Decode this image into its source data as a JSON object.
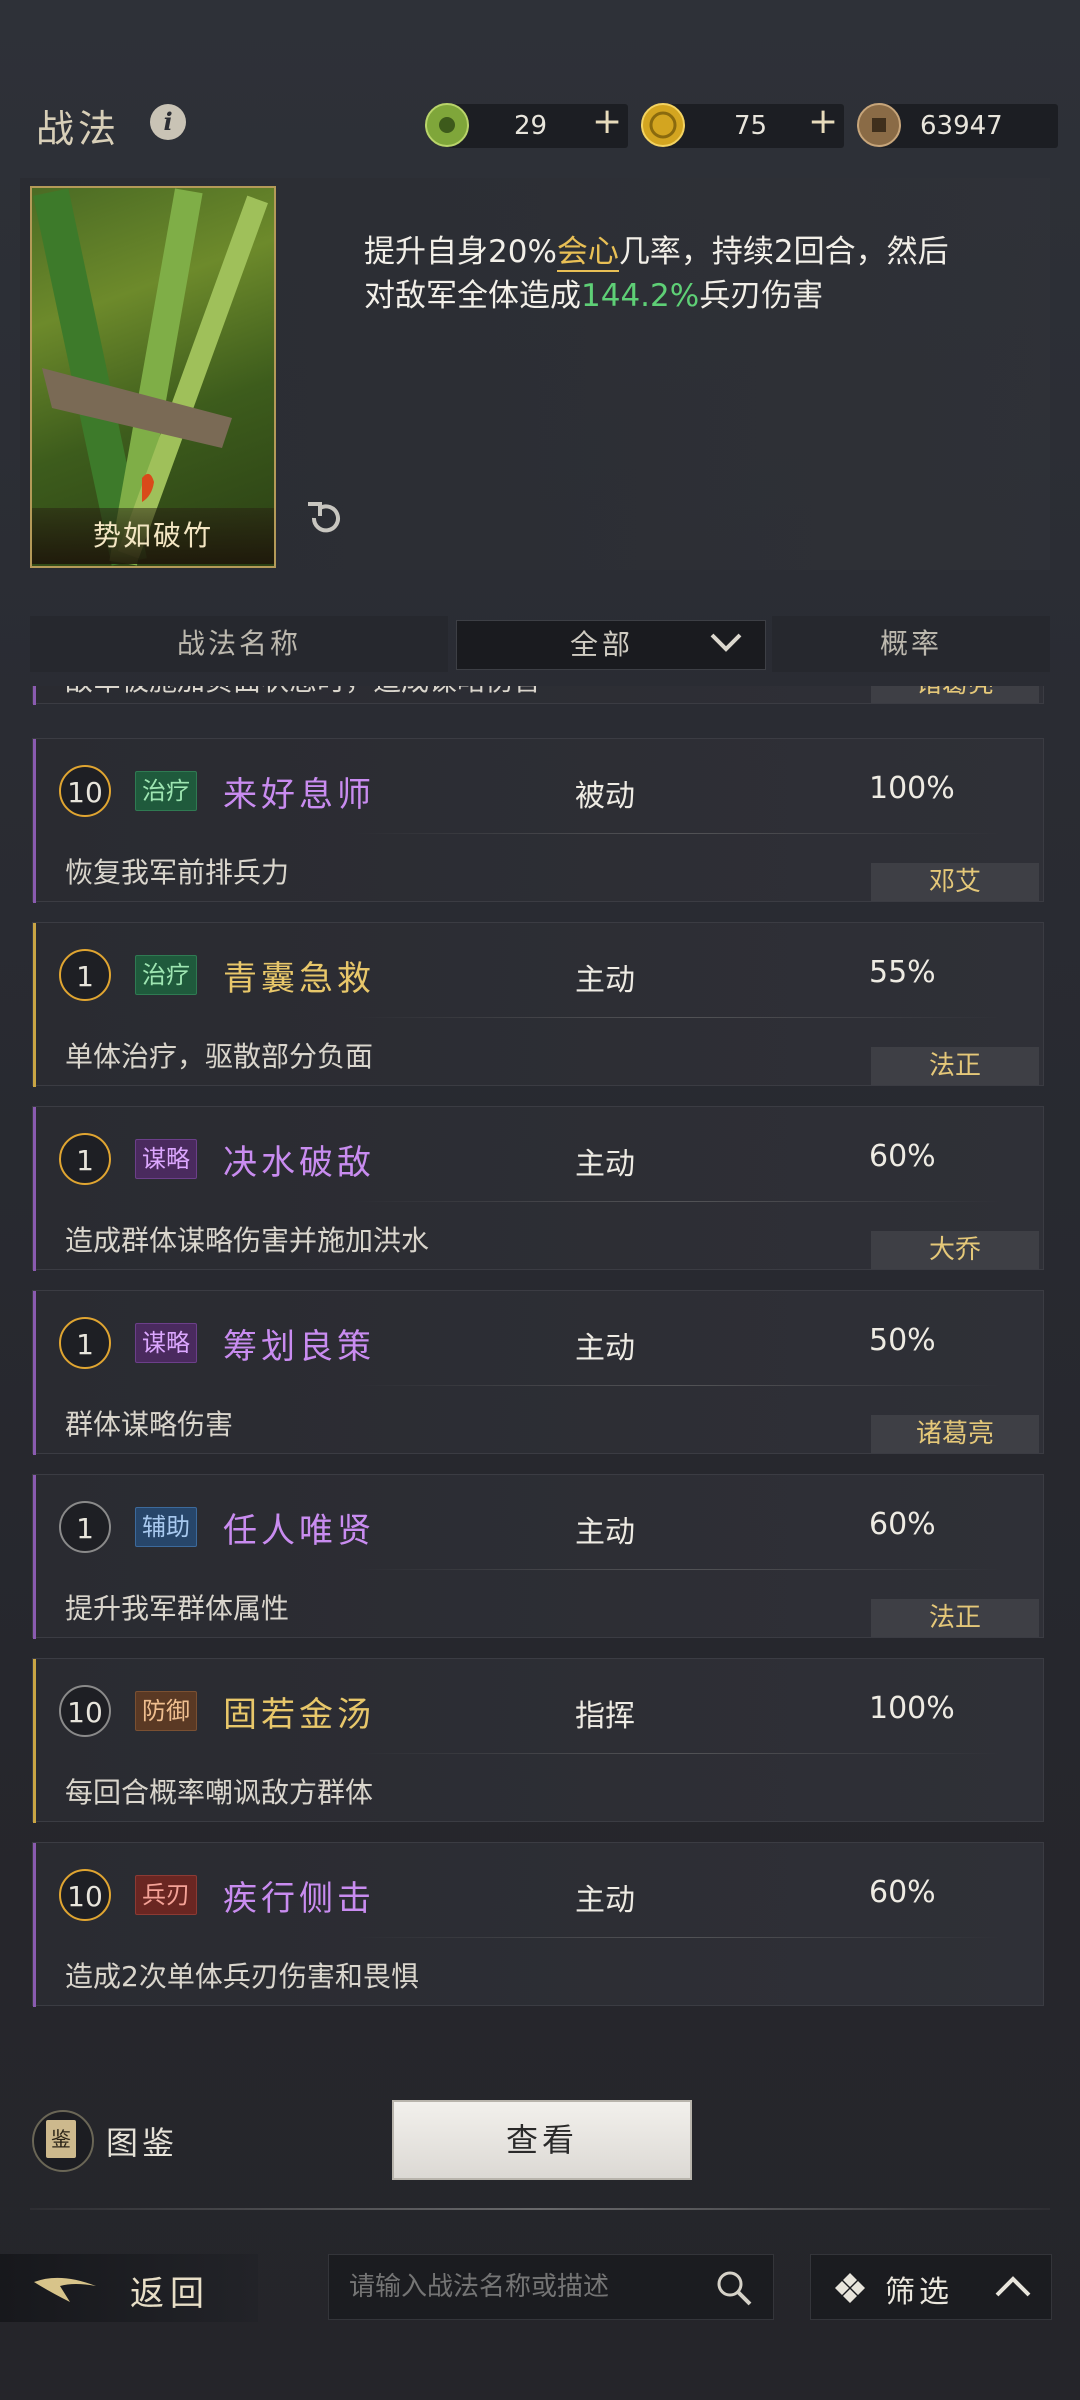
{
  "header": {
    "title": "战法",
    "currencies": [
      {
        "icon": "jade-coin-icon",
        "value": "29"
      },
      {
        "icon": "gold-coin-icon",
        "value": "75"
      },
      {
        "icon": "copper-coin-icon",
        "value": "63947"
      }
    ],
    "plus": "+"
  },
  "detail": {
    "card_name": "势如破竹",
    "desc_1": "提升自身20%",
    "desc_hl1": "会心",
    "desc_2": "几率，持续2回合，然后",
    "desc_3": "对敌军全体造成",
    "desc_hl2": "144.2%",
    "desc_4": "兵刃伤害"
  },
  "columns": {
    "name": "战法名称",
    "filter": "全部",
    "rate": "概率"
  },
  "list": {
    "partial_desc": "敌军被施加负面状态时，造成谋略伤害",
    "partial_owner": "诸葛亮",
    "rows": [
      {
        "cost": "10",
        "tag": "治疗",
        "name": "来好息师",
        "type": "被动",
        "rate": "100%",
        "desc": "恢复我军前排兵力",
        "owner": "邓艾"
      },
      {
        "cost": "1",
        "tag": "治疗",
        "name": "青囊急救",
        "type": "主动",
        "rate": "55%",
        "desc": "单体治疗，驱散部分负面",
        "owner": "法正"
      },
      {
        "cost": "1",
        "tag": "谋略",
        "name": "决水破敌",
        "type": "主动",
        "rate": "60%",
        "desc": "造成群体谋略伤害并施加洪水",
        "owner": "大乔"
      },
      {
        "cost": "1",
        "tag": "谋略",
        "name": "筹划良策",
        "type": "主动",
        "rate": "50%",
        "desc": "群体谋略伤害",
        "owner": "诸葛亮"
      },
      {
        "cost": "1",
        "tag": "辅助",
        "name": "任人唯贤",
        "type": "主动",
        "rate": "60%",
        "desc": "提升我军群体属性",
        "owner": "法正"
      },
      {
        "cost": "10",
        "tag": "防御",
        "name": "固若金汤",
        "type": "指挥",
        "rate": "100%",
        "desc": "每回合概率嘲讽敌方群体",
        "owner": ""
      },
      {
        "cost": "10",
        "tag": "兵刃",
        "name": "疾行侧击",
        "type": "主动",
        "rate": "60%",
        "desc": "造成2次单体兵刃伤害和畏惧",
        "owner": ""
      }
    ]
  },
  "footer": {
    "codex_icon_char": "鉴",
    "codex_label": "图鉴",
    "view_button": "查看",
    "back_label": "返回",
    "search_placeholder": "请输入战法名称或描述",
    "filter_label": "筛选"
  },
  "colors": {
    "gold": "#e8bf55",
    "green": "#5ecf76",
    "purple_name": "#c98cf0",
    "gold_name": "#e8c76a"
  }
}
